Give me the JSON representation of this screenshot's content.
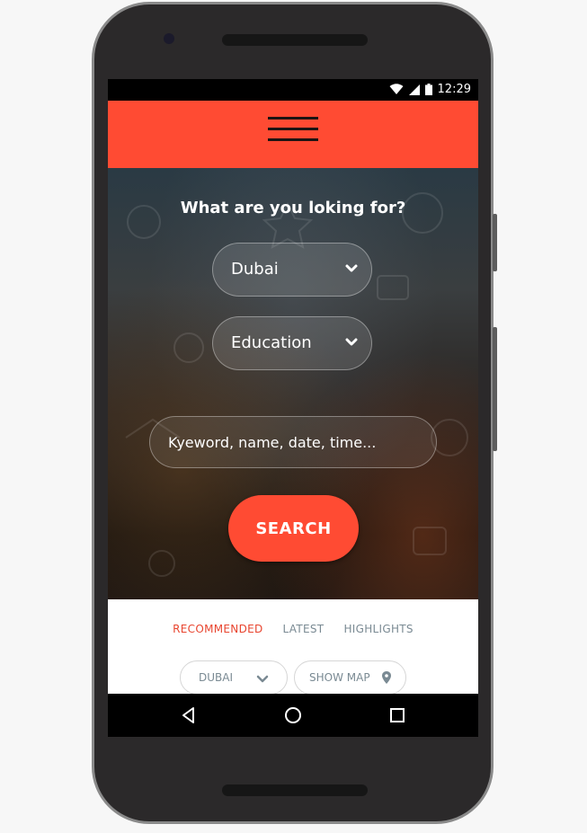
{
  "status_bar": {
    "time": "12:29",
    "icons": [
      "wifi-icon",
      "signal-icon",
      "battery-icon"
    ]
  },
  "app_bar": {
    "color": "#ff4b33",
    "menu_icon": "hamburger-menu-icon"
  },
  "hero": {
    "title": "What are you loking for?",
    "location_select": {
      "value": "Dubai",
      "icon": "chevron-down-icon"
    },
    "category_select": {
      "value": "Education",
      "icon": "chevron-down-icon"
    },
    "keyword_input": {
      "placeholder": "Kyeword, name, date, time...",
      "value": ""
    },
    "search_button": {
      "label": "SEARCH",
      "color": "#ff4b33"
    }
  },
  "tabs": [
    {
      "label": "RECOMMENDED",
      "active": true
    },
    {
      "label": "LATEST",
      "active": false
    },
    {
      "label": "HIGHLIGHTS",
      "active": false
    }
  ],
  "filters": {
    "city_chip": {
      "label": "DUBAI",
      "icon": "chevron-down-icon"
    },
    "map_chip": {
      "label": "SHOW MAP",
      "icon": "map-pin-icon"
    }
  },
  "nav_bar": {
    "buttons": [
      "back-triangle-icon",
      "home-circle-icon",
      "recents-square-icon"
    ]
  },
  "colors": {
    "accent": "#ff4b33",
    "active_tab": "#e8452f",
    "inactive_tab": "#7a8a93"
  }
}
